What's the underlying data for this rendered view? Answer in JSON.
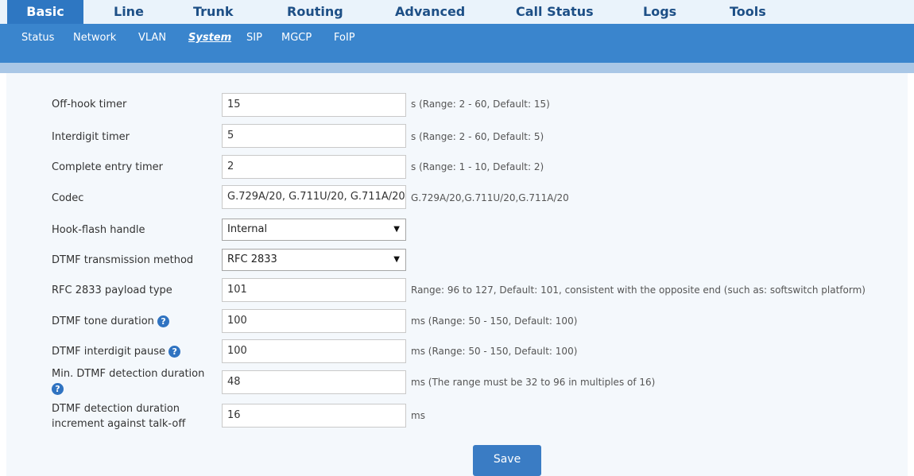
{
  "top_nav": {
    "tabs": [
      "Basic",
      "Line",
      "Trunk",
      "Routing",
      "Advanced",
      "Call Status",
      "Logs",
      "Tools"
    ]
  },
  "sub_nav": {
    "items": [
      "Status",
      "Network",
      "VLAN",
      "System",
      "SIP",
      "MGCP",
      "FoIP"
    ]
  },
  "form": {
    "off_hook": {
      "label": "Off-hook timer",
      "value": "15",
      "hint": "s (Range: 2 - 60, Default: 15)"
    },
    "interdigit": {
      "label": "Interdigit timer",
      "value": "5",
      "hint": "s (Range: 2 - 60, Default: 5)"
    },
    "complete_entry": {
      "label": "Complete entry timer",
      "value": "2",
      "hint": "s (Range: 1 - 10, Default: 2)"
    },
    "codec": {
      "label": "Codec",
      "value": "G.729A/20, G.711U/20, G.711A/20",
      "hint": "G.729A/20,G.711U/20,G.711A/20"
    },
    "hook_flash": {
      "label": "Hook-flash handle",
      "selected": "Internal"
    },
    "dtmf_method": {
      "label": "DTMF transmission method",
      "selected": "RFC 2833"
    },
    "rfc_payload": {
      "label": "RFC 2833 payload type",
      "value": "101",
      "hint": "Range: 96 to 127, Default: 101, consistent with the opposite end (such as: softswitch platform)"
    },
    "dtmf_tone": {
      "label": "DTMF tone duration",
      "value": "100",
      "hint": "ms (Range: 50 - 150, Default: 100)"
    },
    "dtmf_pause": {
      "label": "DTMF interdigit pause",
      "value": "100",
      "hint": "ms (Range: 50 - 150, Default: 100)"
    },
    "min_dtmf": {
      "label": "Min. DTMF detection duration",
      "value": "48",
      "hint": "ms (The range must be 32 to 96 in multiples of 16)"
    },
    "dtmf_increment": {
      "label_line1": "DTMF detection duration",
      "label_line2": "increment against talk-off",
      "value": "16",
      "hint": "ms"
    }
  },
  "help_glyph": "?",
  "select_arrow": "▼",
  "save_label": "Save",
  "colors": {
    "top_nav_bg": "#eaf3fb",
    "active_tab_bg": "#2e77c2",
    "sub_nav_bg": "#3a85cd",
    "strip_bg": "#a9c7e6",
    "content_bg": "#f4f8fc",
    "nav_text": "#1d4f86",
    "help_icon": "#2f73c1",
    "save_button": "#3a7cc4"
  }
}
